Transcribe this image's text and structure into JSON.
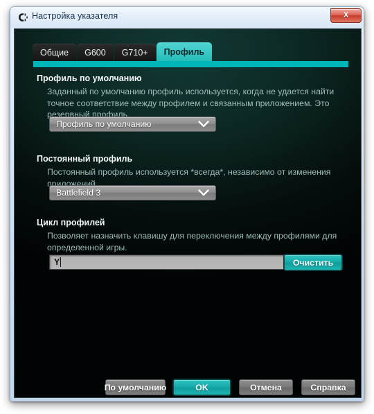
{
  "window": {
    "title": "Настройка указателя",
    "icon": "logitech-mouse-icon",
    "close_label": "X",
    "accent_color": "#00b6b6",
    "titlebar_color": "#e4eef9",
    "client_background": "#0c2723"
  },
  "tabs": [
    {
      "label": "Общие",
      "active": false
    },
    {
      "label": "G600",
      "active": false
    },
    {
      "label": "G710+",
      "active": false
    },
    {
      "label": "Профиль",
      "active": true
    }
  ],
  "sections": [
    {
      "title": "Профиль по умолчанию",
      "description": "Заданный по умолчанию профиль используется, когда не удается найти точное соответствие между профилем и связанным приложением. Это резервный профиль.",
      "dropdown_value": "Профиль по умолчанию"
    },
    {
      "title": "Постоянный профиль",
      "description": "Постоянный профиль используется *всегда*, независимо от изменения приложений.",
      "dropdown_value": "Battlefield 3"
    },
    {
      "title": "Цикл профилей",
      "description": "Позволяет назначить клавишу для переключения между профилями для определенной игры.",
      "input_value": "Y",
      "clear_button": "Очистить"
    }
  ],
  "footer": {
    "defaults_label": "По умолчанию",
    "ok_label": "OK",
    "cancel_label": "Отмена",
    "help_label": "Справка"
  }
}
